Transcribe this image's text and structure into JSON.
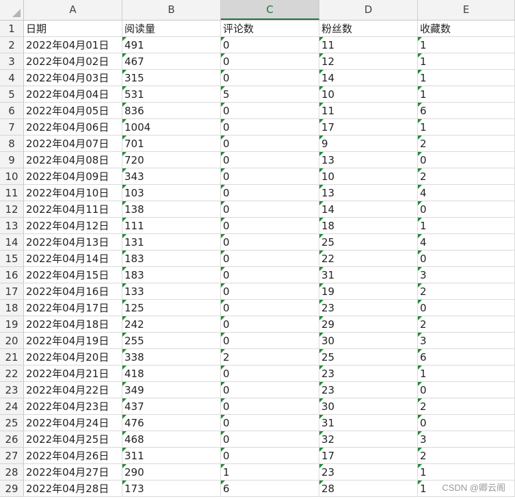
{
  "columns": [
    "A",
    "B",
    "C",
    "D",
    "E"
  ],
  "selected_column": "C",
  "header": {
    "row": "1",
    "cells": [
      "日期",
      "阅读量",
      "评论数",
      "粉丝数",
      "收藏数"
    ]
  },
  "rows": [
    {
      "row": "2",
      "cells": [
        "2022年04月01日",
        "491",
        "0",
        "11",
        "1"
      ]
    },
    {
      "row": "3",
      "cells": [
        "2022年04月02日",
        "467",
        "0",
        "12",
        "1"
      ]
    },
    {
      "row": "4",
      "cells": [
        "2022年04月03日",
        "315",
        "0",
        "14",
        "1"
      ]
    },
    {
      "row": "5",
      "cells": [
        "2022年04月04日",
        "531",
        "5",
        "10",
        "1"
      ]
    },
    {
      "row": "6",
      "cells": [
        "2022年04月05日",
        "836",
        "0",
        "11",
        "6"
      ]
    },
    {
      "row": "7",
      "cells": [
        "2022年04月06日",
        "1004",
        "0",
        "17",
        "1"
      ]
    },
    {
      "row": "8",
      "cells": [
        "2022年04月07日",
        "701",
        "0",
        "9",
        "2"
      ]
    },
    {
      "row": "9",
      "cells": [
        "2022年04月08日",
        "720",
        "0",
        "13",
        "0"
      ]
    },
    {
      "row": "10",
      "cells": [
        "2022年04月09日",
        "343",
        "0",
        "10",
        "2"
      ]
    },
    {
      "row": "11",
      "cells": [
        "2022年04月10日",
        "103",
        "0",
        "13",
        "4"
      ]
    },
    {
      "row": "12",
      "cells": [
        "2022年04月11日",
        "138",
        "0",
        "14",
        "0"
      ]
    },
    {
      "row": "13",
      "cells": [
        "2022年04月12日",
        "111",
        "0",
        "18",
        "1"
      ]
    },
    {
      "row": "14",
      "cells": [
        "2022年04月13日",
        "131",
        "0",
        "25",
        "4"
      ]
    },
    {
      "row": "15",
      "cells": [
        "2022年04月14日",
        "183",
        "0",
        "22",
        "0"
      ]
    },
    {
      "row": "16",
      "cells": [
        "2022年04月15日",
        "183",
        "0",
        "31",
        "3"
      ]
    },
    {
      "row": "17",
      "cells": [
        "2022年04月16日",
        "133",
        "0",
        "19",
        "2"
      ]
    },
    {
      "row": "18",
      "cells": [
        "2022年04月17日",
        "125",
        "0",
        "23",
        "0"
      ]
    },
    {
      "row": "19",
      "cells": [
        "2022年04月18日",
        "242",
        "0",
        "29",
        "2"
      ]
    },
    {
      "row": "20",
      "cells": [
        "2022年04月19日",
        "255",
        "0",
        "30",
        "3"
      ]
    },
    {
      "row": "21",
      "cells": [
        "2022年04月20日",
        "338",
        "2",
        "25",
        "6"
      ]
    },
    {
      "row": "22",
      "cells": [
        "2022年04月21日",
        "418",
        "0",
        "23",
        "1"
      ]
    },
    {
      "row": "23",
      "cells": [
        "2022年04月22日",
        "349",
        "0",
        "23",
        "0"
      ]
    },
    {
      "row": "24",
      "cells": [
        "2022年04月23日",
        "437",
        "0",
        "30",
        "2"
      ]
    },
    {
      "row": "25",
      "cells": [
        "2022年04月24日",
        "476",
        "0",
        "31",
        "0"
      ]
    },
    {
      "row": "26",
      "cells": [
        "2022年04月25日",
        "468",
        "0",
        "32",
        "3"
      ]
    },
    {
      "row": "27",
      "cells": [
        "2022年04月26日",
        "311",
        "0",
        "17",
        "2"
      ]
    },
    {
      "row": "28",
      "cells": [
        "2022年04月27日",
        "290",
        "1",
        "23",
        "1"
      ]
    },
    {
      "row": "29",
      "cells": [
        "2022年04月28日",
        "173",
        "6",
        "28",
        "1"
      ]
    }
  ],
  "watermark": "CSDN @卿云阁",
  "colors": {
    "accent": "#217346",
    "number_stored_as_text_marker": "#1f8b3a"
  }
}
